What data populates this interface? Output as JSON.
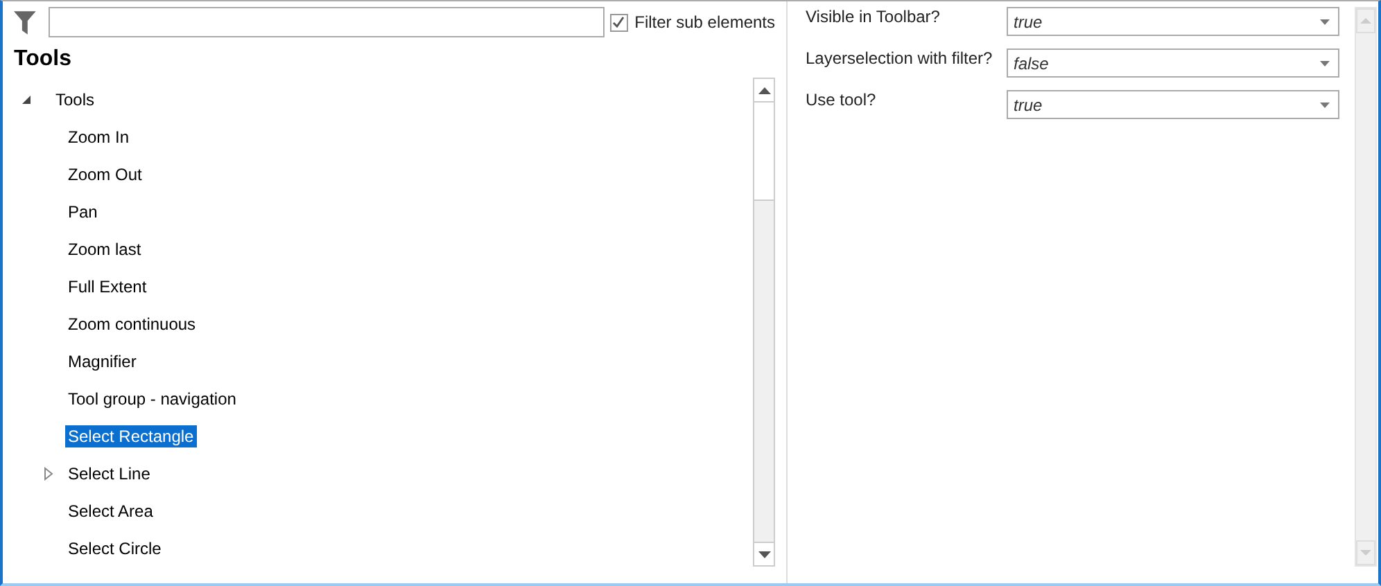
{
  "filter": {
    "checkbox": {
      "label": "Filter sub elements",
      "checked": true
    }
  },
  "heading": "Tools",
  "tree": [
    {
      "label": "Tools",
      "expanded": true,
      "selected": false,
      "children": [
        {
          "label": "Zoom In",
          "selected": false
        },
        {
          "label": "Zoom Out",
          "selected": false
        },
        {
          "label": "Pan",
          "selected": false
        },
        {
          "label": "Zoom last",
          "selected": false
        },
        {
          "label": "Full Extent",
          "selected": false
        },
        {
          "label": "Zoom continuous",
          "selected": false
        },
        {
          "label": "Magnifier",
          "selected": false
        },
        {
          "label": "Tool group - navigation",
          "selected": false
        },
        {
          "label": "Select Rectangle",
          "selected": true
        },
        {
          "label": "Select Line",
          "selected": false,
          "expanded": false
        },
        {
          "label": "Select Area",
          "selected": false
        },
        {
          "label": "Select Circle",
          "selected": false
        }
      ]
    }
  ],
  "properties": [
    {
      "label": "Visible in Toolbar?",
      "value": "true"
    },
    {
      "label": "Layerselection with filter?",
      "value": "false"
    },
    {
      "label": "Use tool?",
      "value": "true"
    }
  ]
}
